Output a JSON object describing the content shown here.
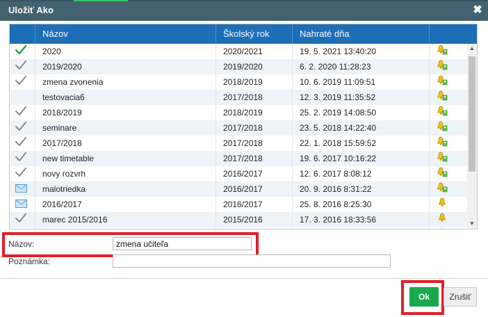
{
  "dialog": {
    "title": "Uložiť Ako",
    "close_icon": "close-icon"
  },
  "grid": {
    "columns": [
      "",
      "Názov",
      "Školský rok",
      "Nahraté dňa",
      ""
    ],
    "rows": [
      {
        "icon": "check-green-icon",
        "name": "2020",
        "year": "2020/2021",
        "uploaded": "19. 5. 2021 13:40:20",
        "action_icon": "bell-users-icon"
      },
      {
        "icon": "check-gray-icon",
        "name": "2019/2020",
        "year": "2019/2020",
        "uploaded": "6. 2. 2020 11:28:23",
        "action_icon": "bell-users-icon"
      },
      {
        "icon": "check-gray-icon",
        "name": "zmena zvonenia",
        "year": "2018/2019",
        "uploaded": "10. 6. 2019 11:09:51",
        "action_icon": "bell-users-icon"
      },
      {
        "icon": "",
        "name": "testovacia6",
        "year": "2017/2018",
        "uploaded": "12. 3. 2019 11:35:52",
        "action_icon": "bell-users-icon"
      },
      {
        "icon": "check-gray-icon",
        "name": "2018/2019",
        "year": "2018/2019",
        "uploaded": "25. 2. 2019 14:08:50",
        "action_icon": "bell-users-icon"
      },
      {
        "icon": "check-gray-icon",
        "name": "seminare",
        "year": "2017/2018",
        "uploaded": "23. 5. 2018 14:22:40",
        "action_icon": "bell-users-icon"
      },
      {
        "icon": "check-gray-icon",
        "name": "2017/2018",
        "year": "2017/2018",
        "uploaded": "22. 1. 2018 15:59:52",
        "action_icon": "bell-users-icon"
      },
      {
        "icon": "check-gray-icon",
        "name": "new timetable",
        "year": "2017/2018",
        "uploaded": "19. 6. 2017 10:16:22",
        "action_icon": "bell-users-icon"
      },
      {
        "icon": "check-gray-icon",
        "name": "novy rozvrh",
        "year": "2016/2017",
        "uploaded": "12. 6. 2017 8:08:12",
        "action_icon": "bell-users-icon"
      },
      {
        "icon": "envelope-icon",
        "name": "malotriedka",
        "year": "2016/2017",
        "uploaded": "20. 9. 2016 8:31:22",
        "action_icon": "bell-users-icon"
      },
      {
        "icon": "envelope-icon",
        "name": "2016/2017",
        "year": "2016/2017",
        "uploaded": "25. 8. 2016 8:25:30",
        "action_icon": "bell-icon"
      },
      {
        "icon": "check-gray-icon",
        "name": "marec 2015/2016",
        "year": "2015/2016",
        "uploaded": "17. 3. 2016 18:33:56",
        "action_icon": "bell-icon"
      },
      {
        "icon": "check-gray-icon",
        "name": "",
        "year": "",
        "uploaded": "",
        "action_icon": "bell-icon"
      }
    ]
  },
  "form": {
    "name_label": "Názov:",
    "name_value": "zmena učiteľa",
    "note_label": "Poznámka:",
    "note_value": ""
  },
  "buttons": {
    "ok_label": "Ok",
    "cancel_label": "Zrušiť"
  },
  "colors": {
    "titlebar": "#44616f",
    "header": "#1c6fb6",
    "ok": "#1aa84d",
    "highlight": "#e01f26"
  }
}
